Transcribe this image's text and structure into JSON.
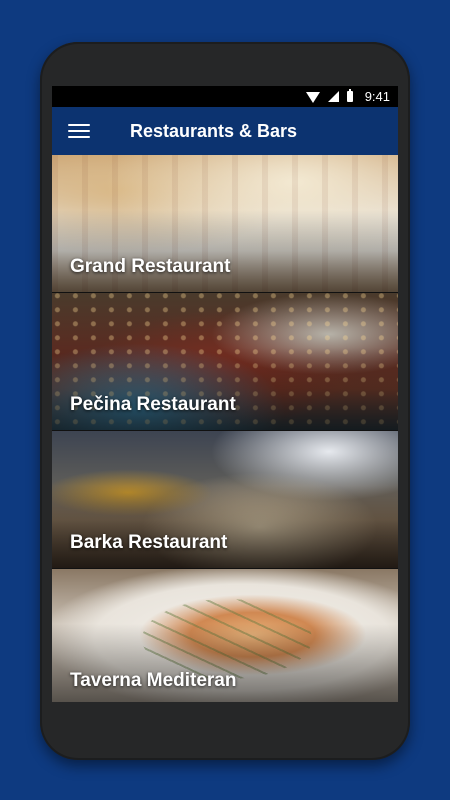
{
  "status_bar": {
    "time": "9:41",
    "icons": [
      "wifi-icon",
      "signal-icon",
      "battery-icon"
    ]
  },
  "app_bar": {
    "title": "Restaurants & Bars",
    "menu_icon": "hamburger-menu-icon"
  },
  "restaurants": [
    {
      "name": "Grand Restaurant"
    },
    {
      "name": "Pečina Restaurant"
    },
    {
      "name": "Barka Restaurant"
    },
    {
      "name": "Taverna Mediteran"
    }
  ],
  "colors": {
    "page_background": "#0e3a80",
    "app_bar": "#0c3370",
    "phone_body": "#262728"
  }
}
